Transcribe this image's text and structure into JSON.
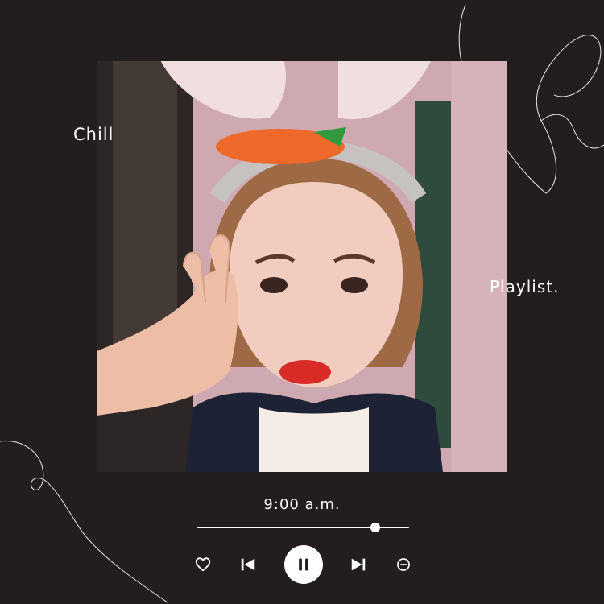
{
  "overlay": {
    "chill": "Chill",
    "playlist": "Playlist."
  },
  "player": {
    "time": "9:00 a.m.",
    "progress": 0.84
  },
  "icons": {
    "like": "heart-icon",
    "previous": "skip-previous-icon",
    "play_pause": "pause-icon",
    "next": "skip-next-icon",
    "remove": "minus-circle-icon"
  },
  "colors": {
    "background": "#221e1f",
    "foreground": "#ffffff"
  }
}
